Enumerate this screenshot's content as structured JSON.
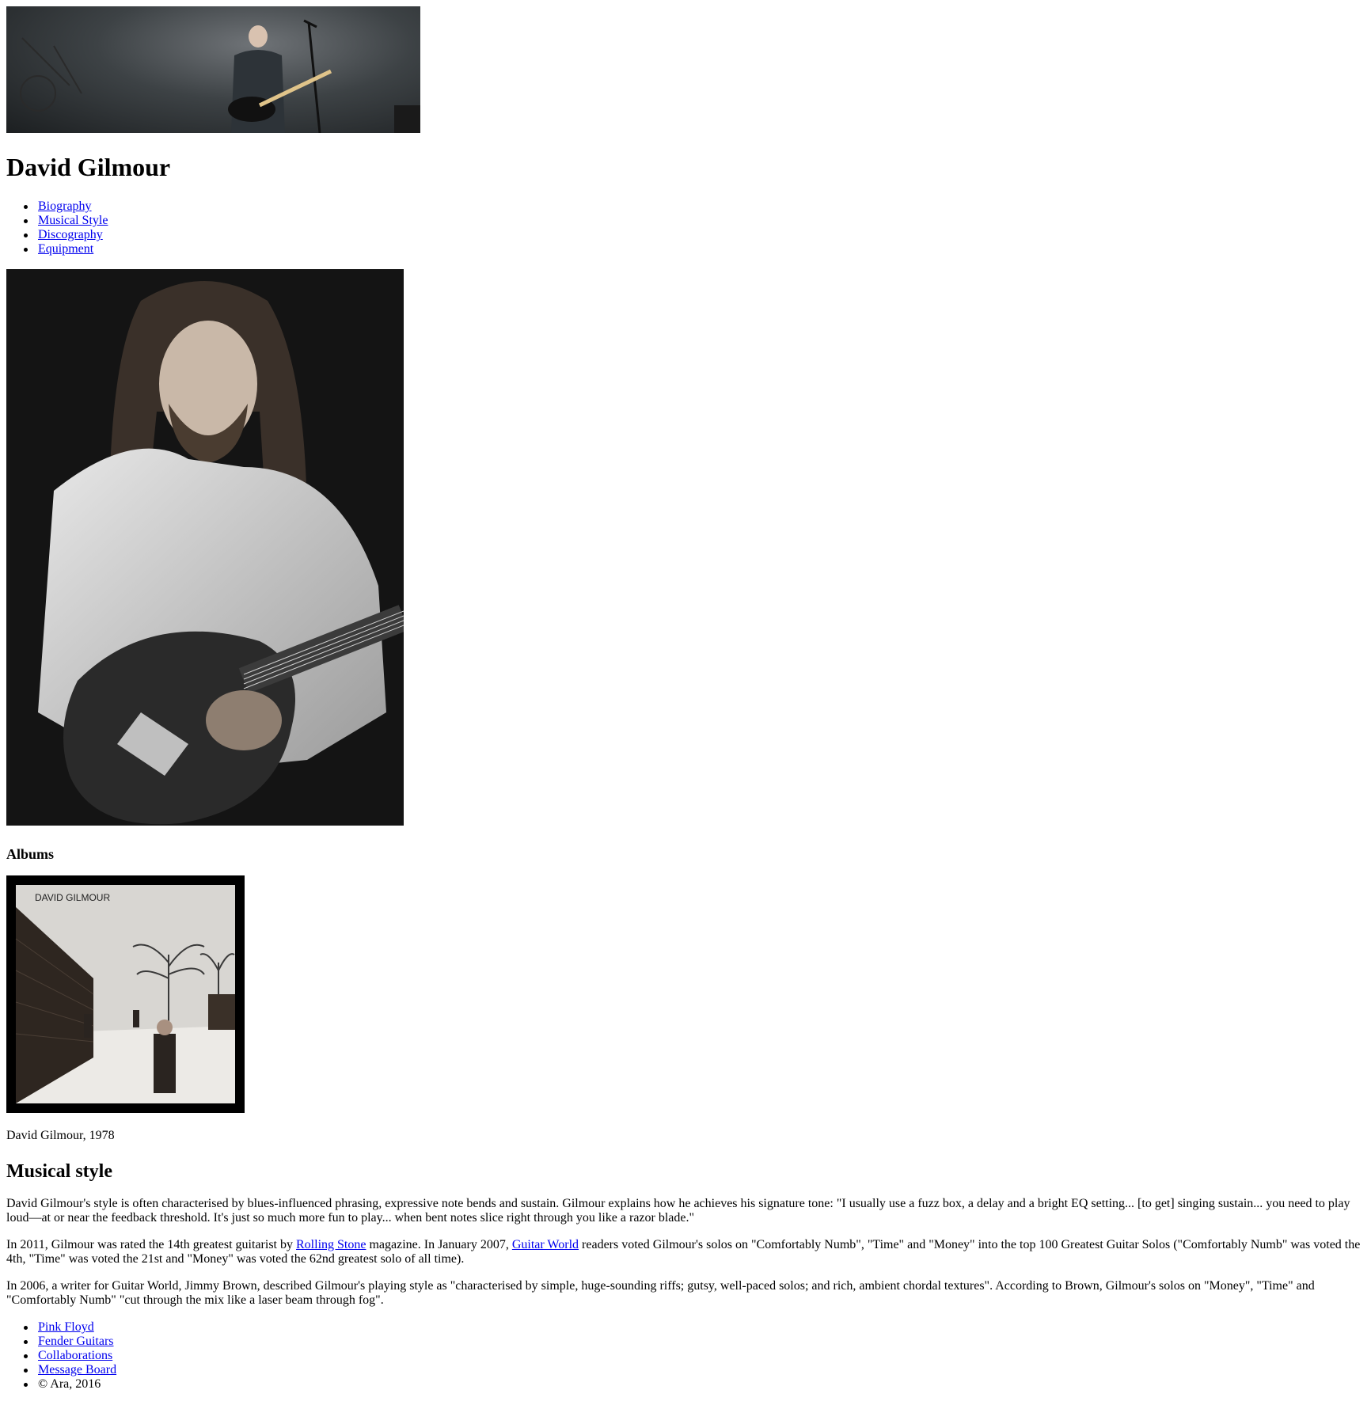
{
  "header": {
    "title": "David Gilmour"
  },
  "nav": {
    "items": [
      "Biography",
      "Musical Style",
      "Discography",
      "Equipment"
    ]
  },
  "albums": {
    "heading": "Albums",
    "cover_text": "DAVID GILMOUR",
    "caption": "David Gilmour, 1978"
  },
  "musical_style": {
    "heading": "Musical style",
    "para1": "David Gilmour's style is often characterised by blues-influenced phrasing, expressive note bends and sustain. Gilmour explains how he achieves his signature tone: \"I usually use a fuzz box, a delay and a bright EQ setting... [to get] singing sustain... you need to play loud—at or near the feedback threshold. It's just so much more fun to play... when bent notes slice right through you like a razor blade.\"",
    "para2_a": "In 2011, Gilmour was rated the 14th greatest guitarist by ",
    "para2_link1": "Rolling Stone",
    "para2_b": " magazine. In January 2007, ",
    "para2_link2": "Guitar World",
    "para2_c": " readers voted Gilmour's solos on \"Comfortably Numb\", \"Time\" and \"Money\" into the top 100 Greatest Guitar Solos (\"Comfortably Numb\" was voted the 4th, \"Time\" was voted the 21st and \"Money\" was voted the 62nd greatest solo of all time).",
    "para3": "In 2006, a writer for Guitar World, Jimmy Brown, described Gilmour's playing style as \"characterised by simple, huge-sounding riffs; gutsy, well-paced solos; and rich, ambient chordal textures\". According to Brown, Gilmour's solos on \"Money\", \"Time\" and \"Comfortably Numb\" \"cut through the mix like a laser beam through fog\"."
  },
  "footer": {
    "links": [
      "Pink Floyd",
      "Fender Guitars",
      "Collaborations",
      "Message Board"
    ],
    "copyright": "© Ara, 2016"
  }
}
